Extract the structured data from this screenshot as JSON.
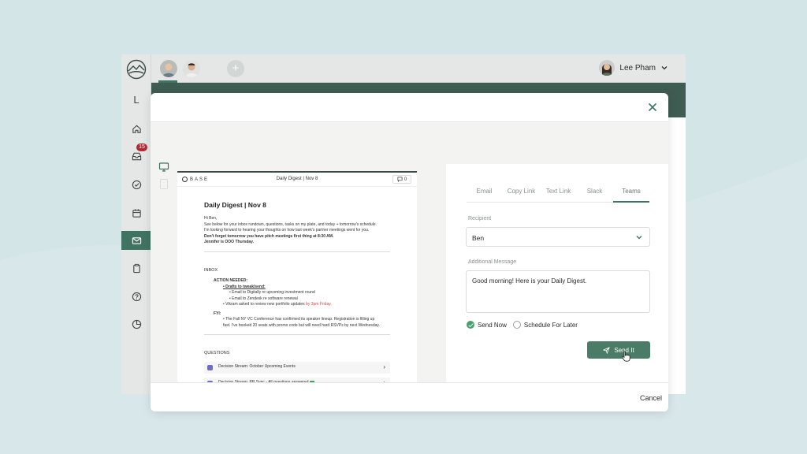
{
  "user": {
    "name": "Lee Pham"
  },
  "sidebar": {
    "letter": "L",
    "inbox_badge": "15",
    "items": [
      {
        "icon": "home-icon"
      },
      {
        "icon": "inbox-icon"
      },
      {
        "icon": "check-circle-icon"
      },
      {
        "icon": "calendar-icon"
      },
      {
        "icon": "mail-icon",
        "active": true
      },
      {
        "icon": "clipboard-icon"
      },
      {
        "icon": "help-icon"
      },
      {
        "icon": "pie-chart-icon"
      }
    ]
  },
  "preview": {
    "logo_text": "BASE",
    "header_title": "Daily Digest | Nov 8",
    "comment_count": "0",
    "title": "Daily Digest | Nov 8",
    "greeting": "Hi Ben,",
    "intro_1": "See below for your inbox rundown, questions, tasks on my plate, and today + tomorrow's schedule.",
    "intro_2": "I'm looking forward to hearing your thoughts on how last week's partner meetings went for you.",
    "intro_bold_1": "Don't forget tomorrow you have pitch meetings first thing at 8:30 AM.",
    "intro_bold_2": "Jennifer is OOO Thursday.",
    "inbox_heading": "INBOX",
    "action_needed": "ACTION NEEDED:",
    "drafts": "Drafts to tweak/send:",
    "draft_1": "Email to Digitally re upcoming investment round",
    "draft_2": "Email to Zendesk re software renewal",
    "vikram": "Vikram asked to review new portfolio updates",
    "vikram_due": "by 3pm Friday.",
    "fyi": "FYI:",
    "fyi_1": "The Fall NY VC Conference has confirmed its speaker lineup. Registration is filling up",
    "fyi_2": "fast. I've booked 20 seats with promo code but will need hard RSVPs by next Wednesday.",
    "questions_heading": "QUESTIONS",
    "stream_1": "Decision Stream:  October Upcoming Events",
    "stream_2": "Decision Stream:  PR Sync - All questions answered"
  },
  "share": {
    "tabs": [
      "Email",
      "Copy Link",
      "Text Link",
      "Slack",
      "Teams"
    ],
    "active_tab": "Teams",
    "recipient_label": "Recipient",
    "recipient_value": "Ben",
    "message_label": "Additional Message",
    "message_value": "Good morning! Here is your Daily Digest.",
    "send_now": "Send Now",
    "schedule_later": "Schedule For Later",
    "send_button": "Send It"
  },
  "footer": {
    "cancel": "Cancel"
  },
  "colors": {
    "accent": "#3f7463",
    "badge": "#b22b32",
    "button": "#4b7c67"
  }
}
